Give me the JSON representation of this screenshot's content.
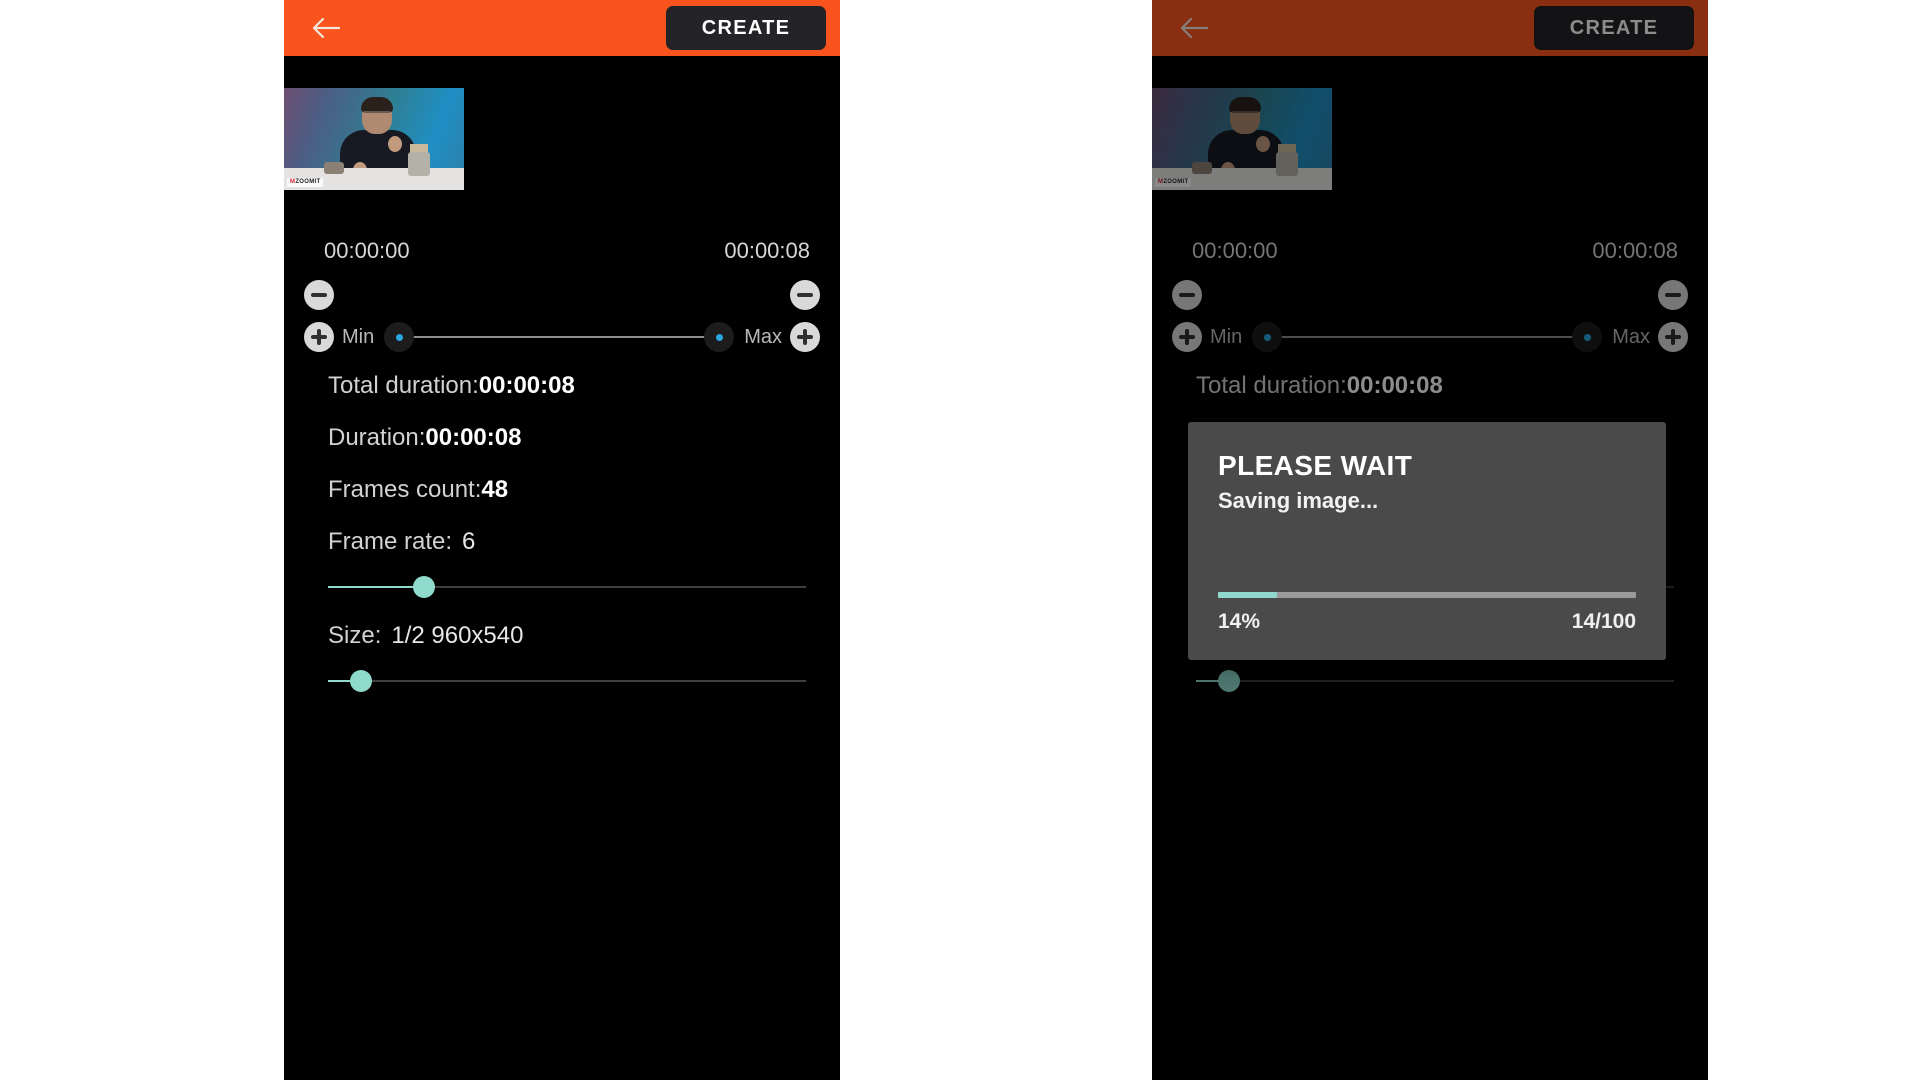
{
  "app": {
    "accent_color": "#f9541e",
    "slider_color": "#8fd9cd",
    "knob_dot_color": "#2aa7e0",
    "panel_background": "#000000"
  },
  "appbar": {
    "back_icon": "arrow-left-icon",
    "create_label": "CREATE"
  },
  "preview": {
    "watermark_mark": "M",
    "watermark_text": "ZOOMIT"
  },
  "timeline": {
    "start_time": "00:00:00",
    "end_time": "00:00:08",
    "min_label": "Min",
    "max_label": "Max",
    "minus_icon": "minus-circle-icon",
    "plus_icon": "plus-circle-icon"
  },
  "info": {
    "total_duration_label": "Total duration:",
    "total_duration_value": "00:00:08",
    "duration_label": "Duration:",
    "duration_value": "00:00:08",
    "frames_count_label": "Frames count:",
    "frames_count_value": "48",
    "frame_rate_label": "Frame rate:",
    "frame_rate_value": "6",
    "size_label": "Size:",
    "size_value": "1/2 960x540"
  },
  "sliders": {
    "frame_rate_percent": 20,
    "size_percent": 7
  },
  "modal": {
    "title": "PLEASE WAIT",
    "subtitle": "Saving image...",
    "progress_percent": 14,
    "percent_label": "14%",
    "count_label": "14/100"
  }
}
